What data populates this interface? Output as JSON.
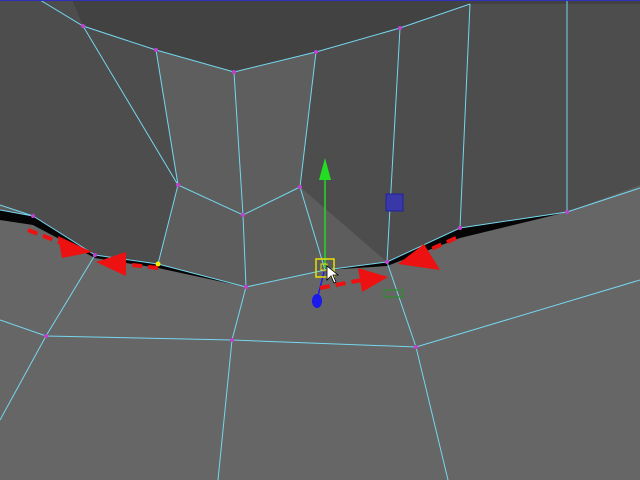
{
  "viewport": {
    "colors": {
      "background": "#5d5d5d",
      "face_light": "#666666",
      "face_mid": "#5e5e5e",
      "face_dark": "#4d4d4d",
      "face_darkest": "#424242",
      "wire": "#74d7ee",
      "vertex": "#c040d0",
      "selected_vertex": "#f4f000",
      "gap": "#050505",
      "top_border": "#3030c0"
    }
  },
  "gizmo": {
    "colors": {
      "y_axis": "#22dd22",
      "x_axis": "#22cc22",
      "z_axis": "#1a1aee",
      "center": "#e8e000",
      "plane_handle": "#3838a8",
      "plane_handle_stroke": "#22229a",
      "secondary_handle": "#2b8f2b"
    }
  },
  "cursor": {
    "icon": "mouse-pointer-icon",
    "color": "#ffffff"
  },
  "annotations": {
    "color": "#ee1111",
    "arrows": [
      {
        "name": "left-outer-arrow-icon"
      },
      {
        "name": "left-inner-arrow-icon"
      },
      {
        "name": "center-right-arrow-icon"
      },
      {
        "name": "right-arrow-icon"
      }
    ]
  }
}
